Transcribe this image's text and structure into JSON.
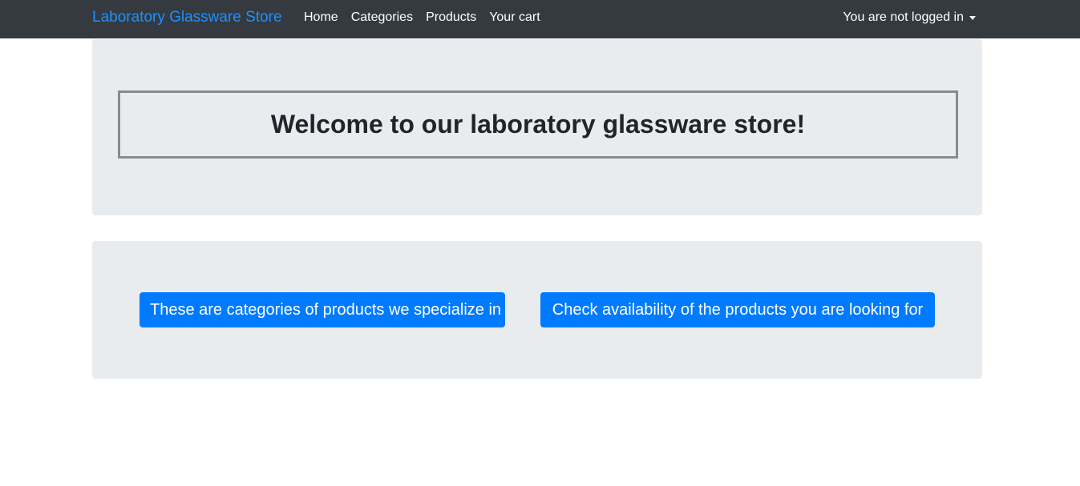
{
  "navbar": {
    "brand": "Laboratory Glassware Store",
    "links": [
      "Home",
      "Categories",
      "Products",
      "Your cart"
    ],
    "user_menu_label": "You are not logged in"
  },
  "welcome": {
    "title": "Welcome to our laboratory glassware store!"
  },
  "actions": {
    "categories_button": "These are categories of products we specialize in",
    "availability_button": "Check availability of the products you are looking for"
  },
  "colors": {
    "navbar_bg": "#343a40",
    "brand": "#1e90ff",
    "jumbotron_bg": "#e9ecef",
    "primary": "#007bff"
  }
}
